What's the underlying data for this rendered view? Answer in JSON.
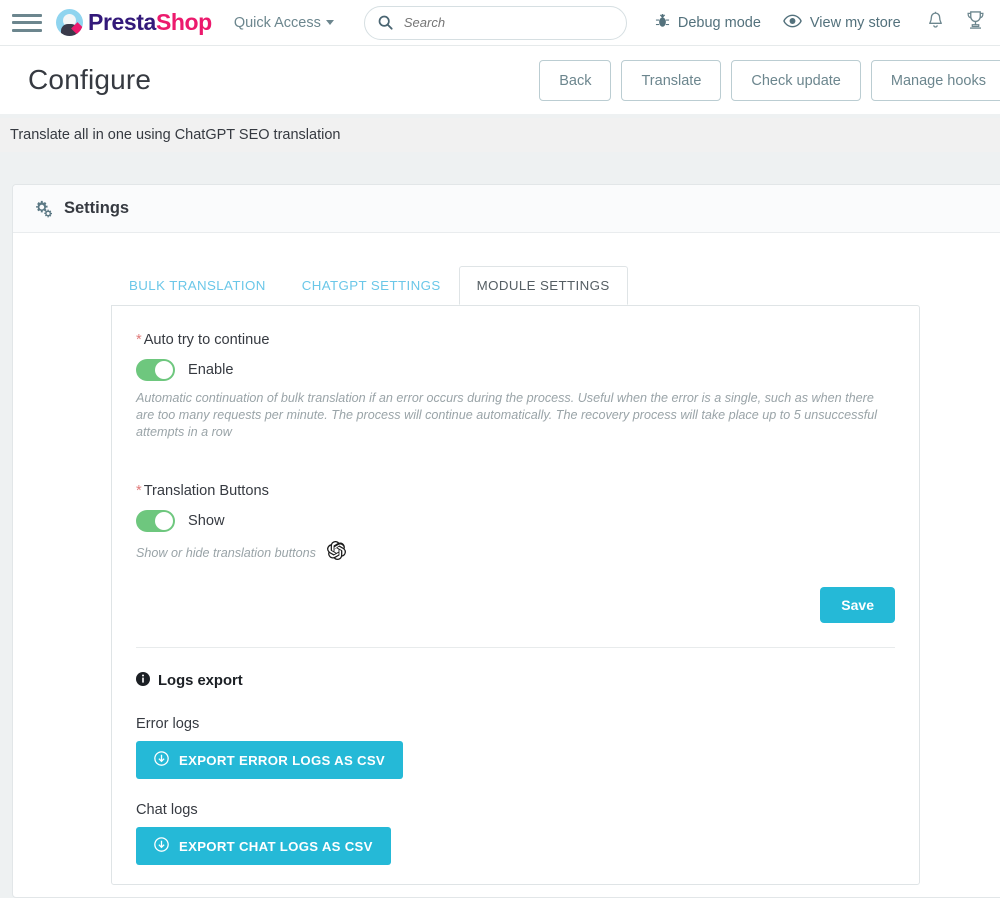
{
  "topnav": {
    "menu_icon": "hamburger-icon",
    "brand_part1": "Presta",
    "brand_part2": "Shop",
    "quick_access": "Quick Access",
    "search": {
      "placeholder": "Search",
      "value": "",
      "icon": "search-icon"
    },
    "debug_mode": "Debug mode",
    "view_store": "View my store",
    "bell_icon": "bell-icon",
    "trophy_icon": "trophy-icon"
  },
  "header": {
    "title": "Configure",
    "actions": [
      {
        "label": "Back"
      },
      {
        "label": "Translate"
      },
      {
        "label": "Check update"
      },
      {
        "label": "Manage hooks"
      }
    ]
  },
  "subbar": {
    "text": "Translate all in one using ChatGPT SEO translation"
  },
  "card": {
    "header_icon": "gears-icon",
    "header_title": "Settings"
  },
  "tabs": [
    {
      "label": "BULK TRANSLATION",
      "active": false
    },
    {
      "label": "CHATGPT SETTINGS",
      "active": false
    },
    {
      "label": "MODULE SETTINGS",
      "active": true
    }
  ],
  "module_settings": {
    "auto_continue": {
      "label": "Auto try to continue",
      "required_mark": "*",
      "toggle_state": "on",
      "toggle_label": "Enable",
      "help": "Automatic continuation of bulk translation if an error occurs during the process. Useful when the error is a single, such as when there are too many requests per minute. The process will continue automatically. The recovery process will take place up to 5 unsuccessful attempts in a row"
    },
    "translation_buttons": {
      "label": "Translation Buttons",
      "required_mark": "*",
      "toggle_state": "on",
      "toggle_label": "Show",
      "help": "Show or hide translation buttons",
      "badge_icon": "openai-icon"
    },
    "save_label": "Save",
    "logs_export": {
      "icon": "info-icon",
      "title": "Logs export",
      "error_logs_label": "Error logs",
      "error_logs_button": "EXPORT ERROR LOGS AS CSV",
      "chat_logs_label": "Chat logs",
      "chat_logs_button": "EXPORT CHAT LOGS AS CSV",
      "button_icon": "download-circle-icon"
    }
  },
  "colors": {
    "accent": "#25b9d7",
    "tab_link": "#6bc7e8",
    "toggle_on": "#6ec77e",
    "brand_pink": "#ec1a6d",
    "brand_purple": "#33197a",
    "required": "#e07b7b",
    "page_bg": "#eef1f2"
  }
}
